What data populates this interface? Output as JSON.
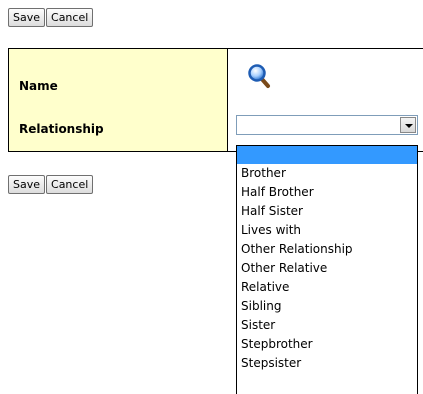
{
  "top_buttons": {
    "save": "Save",
    "cancel": "Cancel"
  },
  "bottom_buttons": {
    "save": "Save",
    "cancel": "Cancel"
  },
  "form": {
    "name_label": "Name",
    "relationship_label": "Relationship",
    "relationship_value": ""
  },
  "dropdown": {
    "options": [
      "",
      "Brother",
      "Half Brother",
      "Half Sister",
      "Lives with",
      "Other Relationship",
      "Other Relative",
      "Relative",
      "Sibling",
      "Sister",
      "Stepbrother",
      "Stepsister"
    ],
    "highlighted_index": 0
  },
  "colors": {
    "label_bg": "#ffffcc",
    "highlight": "#3399ff"
  }
}
